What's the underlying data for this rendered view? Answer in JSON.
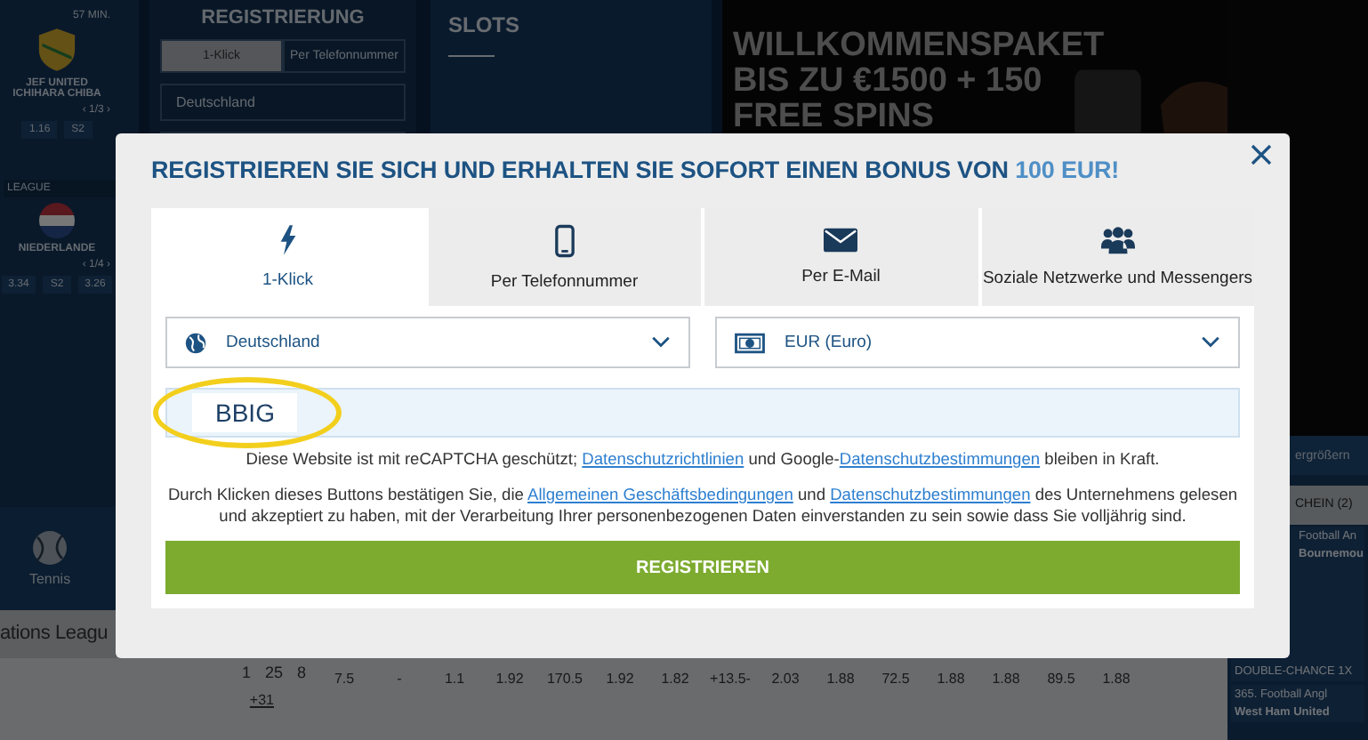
{
  "background": {
    "match_widget": {
      "time": "57 MIN.",
      "team": "JEF UNITED ICHIHARA CHIBA",
      "pager": "‹ 1/3 ›",
      "odds": [
        "1.16",
        "S2"
      ],
      "league": "LEAGUE",
      "team_2": "NIEDERLANDE",
      "pager_2": "‹ 1/4 ›",
      "odds_2": [
        "3.34",
        "S2",
        "3.26"
      ]
    },
    "registration_widget": {
      "title": "REGISTRIERUNG",
      "tabs": [
        {
          "label": "1-Klick",
          "selected": true
        },
        {
          "label": "Per Telefonnummer",
          "selected": false
        }
      ],
      "country": "Deutschland"
    },
    "slots": {
      "title": "SLOTS"
    },
    "promo": {
      "lines": [
        "WILLKOMMENSPAKET",
        "BIS ZU €1500 + 150",
        "FREE SPINS"
      ]
    },
    "sports": [
      {
        "label": "Tennis"
      }
    ],
    "section_title": "ations Leagu",
    "odds_row": {
      "counts": [
        "1",
        "25",
        "8"
      ],
      "more": "+31",
      "cells": [
        "7.5",
        "-",
        "1.1",
        "1.92",
        "170.5",
        "1.92",
        "1.82",
        "+13.5-",
        "2.03",
        "1.88",
        "72.5",
        "1.88",
        "1.88",
        "89.5",
        "1.88"
      ]
    },
    "sidebar": {
      "zoom": "ergrößern",
      "betslip": "CHEIN (2)",
      "bets": [
        {
          "league": "Football An",
          "teams": "Bournemou",
          "market": "DOUBLE-CHANCE 1X"
        },
        {
          "league": "365. Football Angl",
          "teams": "West Ham United"
        }
      ]
    }
  },
  "modal": {
    "title": "REGISTRIEREN SIE SICH UND ERHALTEN SIE SOFORT EINEN BONUS VON",
    "bonus": "100 EUR!",
    "tabs": [
      {
        "label": "1-Klick",
        "selected": true
      },
      {
        "label": "Per Telefonnummer",
        "selected": false
      },
      {
        "label": "Per E-Mail",
        "selected": false
      },
      {
        "label": "Soziale Netzwerke und Messengers",
        "selected": false
      }
    ],
    "selects": [
      {
        "value": "Deutschland"
      },
      {
        "value": "EUR (Euro)"
      }
    ],
    "promo_code": {
      "value": "BBIG",
      "highlighted": true
    },
    "recaptcha_notice": [
      {
        "kind": "text",
        "text": "Diese Website ist mit reCAPTCHA geschützt; "
      },
      {
        "kind": "link",
        "text": "Datenschutzrichtlinien"
      },
      {
        "kind": "text",
        "text": " und Google-"
      },
      {
        "kind": "link",
        "text": "Datenschutzbestimmungen"
      },
      {
        "kind": "text",
        "text": " bleiben in Kraft."
      }
    ],
    "consent": [
      {
        "kind": "text",
        "text": "Durch Klicken dieses Buttons bestätigen Sie, die "
      },
      {
        "kind": "link",
        "text": "Allgemeinen Geschäftsbedingungen"
      },
      {
        "kind": "text",
        "text": " und "
      },
      {
        "kind": "link",
        "text": "Datenschutzbestimmungen"
      },
      {
        "kind": "text",
        "text": " des Unternehmens gelesen und akzeptiert zu haben, mit der Verarbeitung Ihrer personenbezogenen Daten einverstanden zu sein sowie dass Sie volljährig sind."
      }
    ],
    "submit": "REGISTRIEREN"
  }
}
